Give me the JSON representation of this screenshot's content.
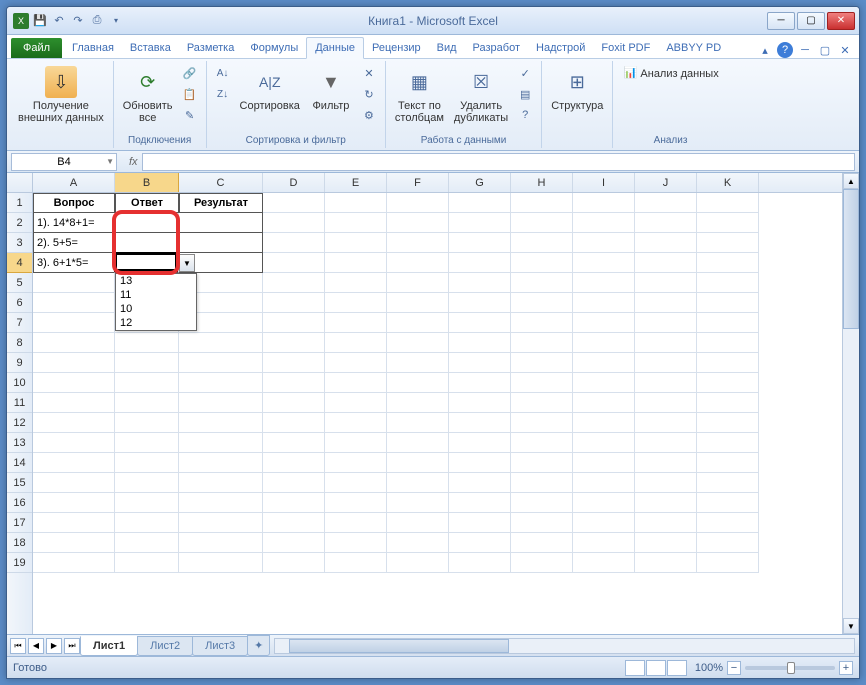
{
  "title": "Книга1 - Microsoft Excel",
  "qat": [
    "xl",
    "save",
    "undo",
    "redo",
    "print",
    "more"
  ],
  "tabs": {
    "file": "Файл",
    "items": [
      "Главная",
      "Вставка",
      "Разметка",
      "Формулы",
      "Данные",
      "Рецензир",
      "Вид",
      "Разработ",
      "Надстрой",
      "Foxit PDF",
      "ABBYY PD"
    ],
    "active_index": 4
  },
  "ribbon": {
    "groups": [
      {
        "label": "",
        "big": [
          {
            "name": "get-external-data",
            "label": "Получение\nвнешних данных",
            "color": "#f0b050"
          }
        ]
      },
      {
        "label": "Подключения",
        "big": [
          {
            "name": "refresh-all",
            "label": "Обновить\nвсе",
            "color": "#4a90d9"
          }
        ]
      },
      {
        "label": "Сортировка и фильтр",
        "big": [
          {
            "name": "sort-az",
            "label": "",
            "color": "#6aa0e0"
          },
          {
            "name": "sort",
            "label": "Сортировка",
            "color": "#6aa0e0"
          },
          {
            "name": "filter",
            "label": "Фильтр",
            "color": "#888"
          }
        ]
      },
      {
        "label": "Работа с данными",
        "big": [
          {
            "name": "text-to-columns",
            "label": "Текст по\nстолбцам",
            "color": "#6aa0e0"
          },
          {
            "name": "remove-dupes",
            "label": "Удалить\nдубликаты",
            "color": "#6aa0e0"
          }
        ]
      },
      {
        "label": "",
        "big": [
          {
            "name": "structure",
            "label": "Структура",
            "color": "#6aa0e0"
          }
        ]
      },
      {
        "label": "Анализ",
        "big": [
          {
            "name": "data-analysis",
            "label": "Анализ данных",
            "color": "#6aa0e0"
          }
        ]
      }
    ]
  },
  "namebox": "B4",
  "fx": "fx",
  "formula": "",
  "columns": [
    "A",
    "B",
    "C",
    "D",
    "E",
    "F",
    "G",
    "H",
    "I",
    "J",
    "K"
  ],
  "col_widths": [
    "cA",
    "cB",
    "cC",
    "cD",
    "cE",
    "cF",
    "cG",
    "cH",
    "cI",
    "cJ",
    "cK"
  ],
  "rows": [
    1,
    2,
    3,
    4,
    5,
    6,
    7,
    8,
    9,
    10,
    11,
    12,
    13,
    14,
    15,
    16,
    17,
    18,
    19
  ],
  "cells": {
    "A1": "Вопрос",
    "B1": "Ответ",
    "C1": "Результат",
    "A2": "1). 14*8+1=",
    "A3": "2). 5+5=",
    "A4": "3). 6+1*5="
  },
  "dropdown": [
    "13",
    "11",
    "10",
    "12"
  ],
  "sheets": {
    "active": "Лист1",
    "others": [
      "Лист2",
      "Лист3"
    ]
  },
  "status": "Готово",
  "zoom": "100%",
  "plus": "+",
  "minus": "−"
}
